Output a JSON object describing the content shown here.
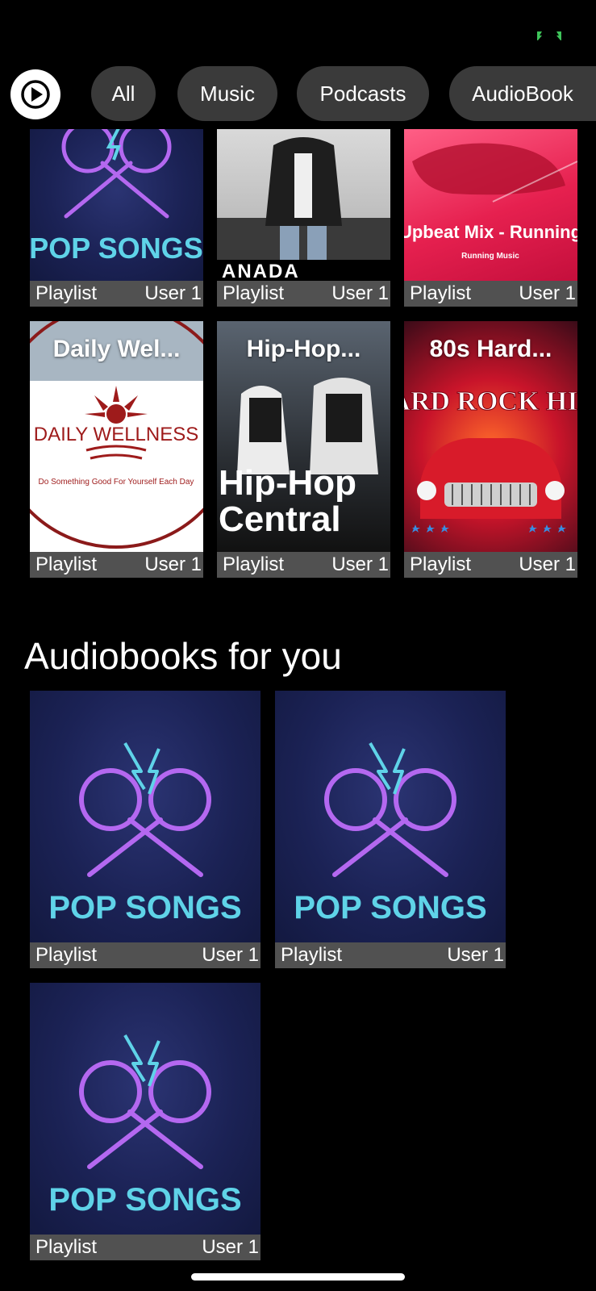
{
  "status": {
    "battery_icon": "battery-charging-icon",
    "accent": "#3ec45a"
  },
  "filters": {
    "player_icon": "play-circle-icon",
    "chips": [
      {
        "label": "All"
      },
      {
        "label": "Music"
      },
      {
        "label": "Podcasts"
      },
      {
        "label": "AudioBook"
      }
    ]
  },
  "playlists_row1": [
    {
      "art_text": "POP SONGS",
      "type": "Playlist",
      "owner": "User 1"
    },
    {
      "art_text": "ANADA",
      "type": "Playlist",
      "owner": "User 1"
    },
    {
      "art_text": "Upbeat Mix - Running",
      "art_sub": "Running Music",
      "type": "Playlist",
      "owner": "User 1"
    }
  ],
  "playlists_row2": [
    {
      "title": "Daily Wel...",
      "art_text": "DAILY WELLNESS",
      "art_sub": "Do Something Good For Yourself Each Day",
      "type": "Playlist",
      "owner": "User 1"
    },
    {
      "title": "Hip-Hop...",
      "art_text": "Hip-Hop",
      "art_sub": "Central",
      "type": "Playlist",
      "owner": "User 1"
    },
    {
      "title": "80s Hard...",
      "art_text": "HARD ROCK HITS",
      "type": "Playlist",
      "owner": "User 1"
    }
  ],
  "audiobooks": {
    "heading": "Audiobooks for you",
    "items": [
      {
        "art_text": "POP SONGS",
        "type": "Playlist",
        "owner": "User 1"
      },
      {
        "art_text": "POP SONGS",
        "type": "Playlist",
        "owner": "User 1"
      },
      {
        "art_text": "POP SONGS",
        "type": "Playlist",
        "owner": "User 1"
      }
    ]
  },
  "colors": {
    "background": "#000000",
    "chip": "#3a3a3a",
    "caption": "#585858",
    "neon_text": "#5fd3e8",
    "neon_mic": "#b468f0"
  }
}
